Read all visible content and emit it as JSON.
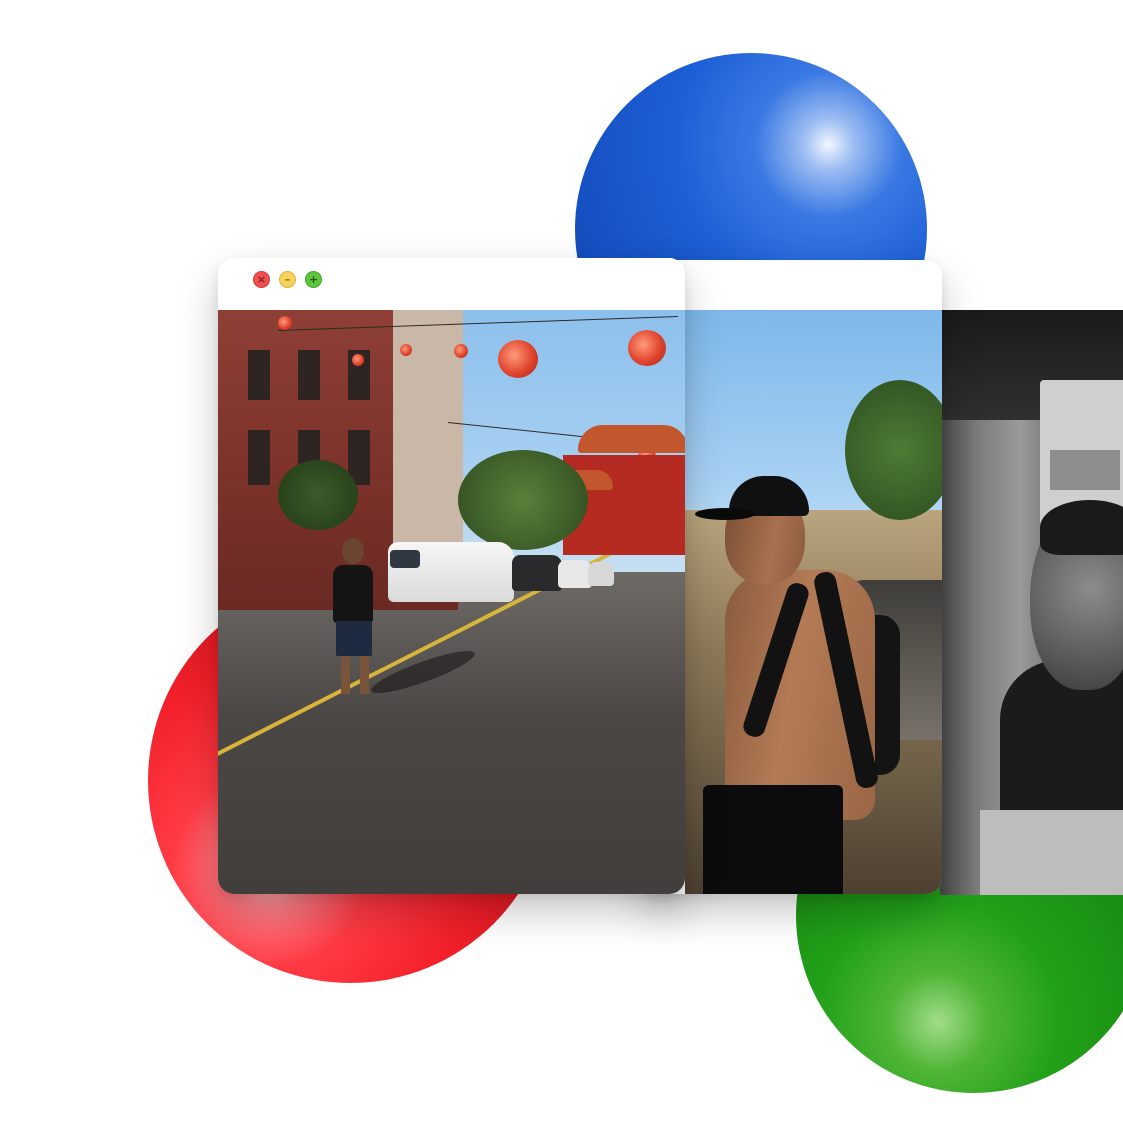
{
  "window": {
    "controls": {
      "close_icon": "close-icon",
      "minimize_icon": "minimize-icon",
      "maximize_icon": "maximize-icon",
      "close_glyph": "×",
      "minimize_glyph": "–",
      "maximize_glyph": "+"
    }
  },
  "gallery": {
    "photos": [
      {
        "subject": "street-photo",
        "tone": "color"
      },
      {
        "subject": "hike-photo",
        "tone": "color"
      },
      {
        "subject": "portrait-photo",
        "tone": "grayscale"
      }
    ]
  },
  "decor": {
    "colors": {
      "blue_sphere": "#1d5fd6",
      "red_sphere": "#f2202a",
      "green_sphere": "#1a8f13",
      "close_button": "#ee4f4f",
      "minimize_button": "#f7d25a",
      "maximize_button": "#5fc43e"
    }
  }
}
